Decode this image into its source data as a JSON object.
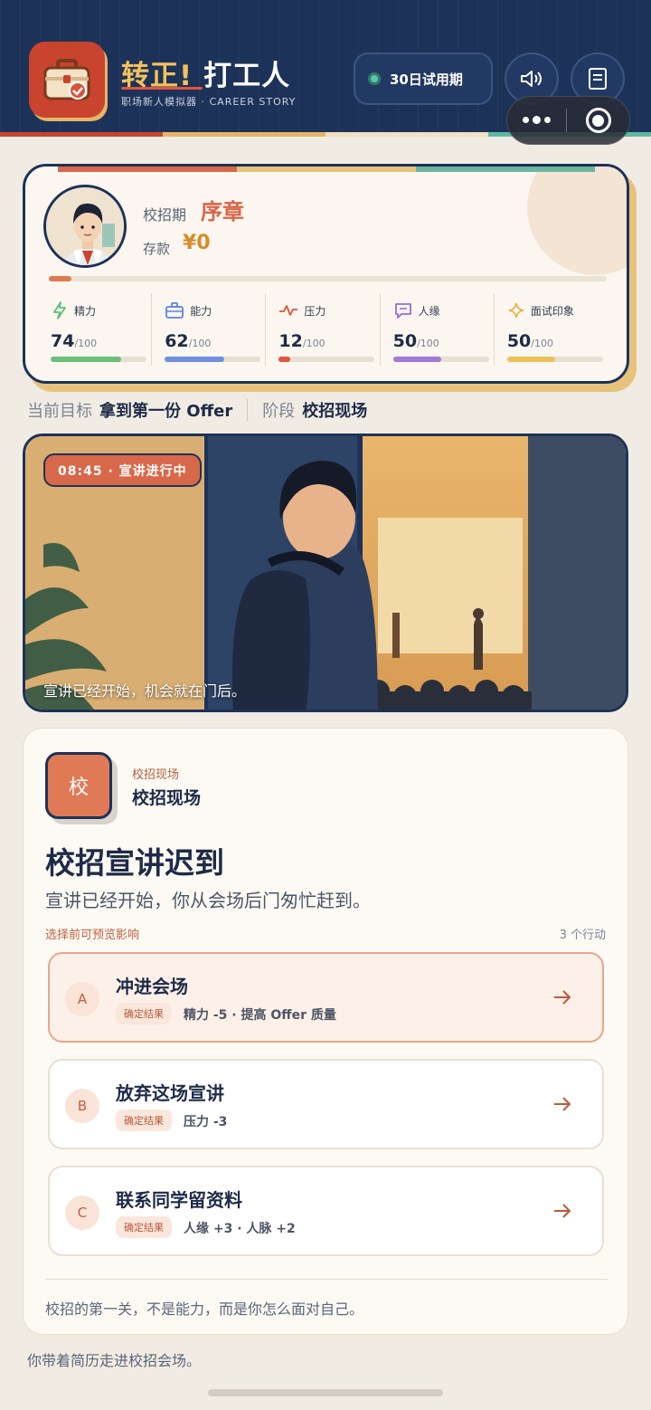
{
  "header": {
    "title_part1": "转正!",
    "title_part2": "打工人",
    "subtitle": "职场新人模拟器 · CAREER STORY",
    "trial_label": "30日试用期",
    "stripe_colors": [
      "#c8442e",
      "#e6b56a",
      "#f0e0c0",
      "#5fb8a0"
    ]
  },
  "status": {
    "period_label": "校招期",
    "period_value": "序章",
    "money_label": "存款",
    "money_value": "¥0",
    "overall_progress": 0.04,
    "stats": [
      {
        "name": "精力",
        "value": "74",
        "max": "/100",
        "fraction": 0.74,
        "color": "#6bbf7a",
        "icon": "lightning-icon"
      },
      {
        "name": "能力",
        "value": "62",
        "max": "/100",
        "fraction": 0.62,
        "color": "#6f8fe0",
        "icon": "briefcase-icon"
      },
      {
        "name": "压力",
        "value": "12",
        "max": "/100",
        "fraction": 0.12,
        "color": "#e0553c",
        "icon": "pulse-icon"
      },
      {
        "name": "人缘",
        "value": "50",
        "max": "/100",
        "fraction": 0.5,
        "color": "#a07ad8",
        "icon": "chat-icon"
      },
      {
        "name": "面试印象",
        "value": "50",
        "max": "/100",
        "fraction": 0.5,
        "color": "#eec05a",
        "icon": "sparkle-icon"
      }
    ]
  },
  "goal": {
    "label": "当前目标",
    "value": "拿到第一份 Offer",
    "stage_label": "阶段",
    "stage_value": "校招现场"
  },
  "scene": {
    "badge": "08:45 · 宣讲进行中",
    "caption": "宣讲已经开始，机会就在门后。"
  },
  "event": {
    "icon_char": "校",
    "category": "校招现场",
    "place": "校招现场",
    "title": "校招宣讲迟到",
    "description": "宣讲已经开始，你从会场后门匆忙赶到。",
    "preview_hint": "选择前可预览影响",
    "action_count": "3 个行动",
    "options": [
      {
        "letter": "A",
        "label": "冲进会场",
        "tag": "确定结果",
        "effect": "精力 -5 · 提高 Offer 质量"
      },
      {
        "letter": "B",
        "label": "放弃这场宣讲",
        "tag": "确定结果",
        "effect": "压力 -3"
      },
      {
        "letter": "C",
        "label": "联系同学留资料",
        "tag": "确定结果",
        "effect": "人缘 +3 · 人脉 +2"
      }
    ],
    "footer": "校招的第一关，不是能力，而是你怎么面对自己。"
  },
  "bottom_text": "你带着简历走进校招会场。"
}
